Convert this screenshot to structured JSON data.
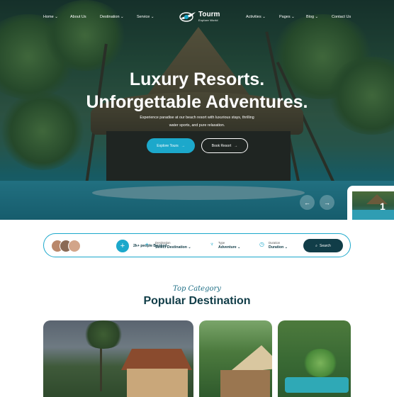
{
  "nav": {
    "items": [
      {
        "label": "Home",
        "dropdown": true
      },
      {
        "label": "About Us",
        "dropdown": false
      },
      {
        "label": "Destination",
        "dropdown": true
      },
      {
        "label": "Service",
        "dropdown": true
      },
      {
        "label": "Activities",
        "dropdown": true
      },
      {
        "label": "Pages",
        "dropdown": true
      },
      {
        "label": "Blog",
        "dropdown": true
      },
      {
        "label": "Contact Us",
        "dropdown": false
      }
    ],
    "logo": {
      "name": "Tourm",
      "tagline": "Explore World"
    }
  },
  "hero": {
    "title_line1": "Luxury Resorts.",
    "title_line2": "Unforgettable Adventures.",
    "subtitle_line1": "Experience paradise at our beach resort with luxurious stays, thrilling",
    "subtitle_line2": "water sports, and pure relaxation.",
    "explore_label": "Explore Tours",
    "book_label": "Book Resort",
    "slide_number": "1"
  },
  "search": {
    "booked_text": "2k+ people Booked",
    "destination": {
      "label": "Destination",
      "value": "Select Destination"
    },
    "type": {
      "label": "Type",
      "value": "Adventure"
    },
    "duration": {
      "label": "Duration",
      "value": "Duration"
    },
    "button_label": "Search"
  },
  "section": {
    "kicker": "Top Category",
    "title": "Popular Destination"
  },
  "colors": {
    "accent": "#1ca8cb",
    "dark": "#113d48"
  },
  "icons": [
    "chevron-down-icon",
    "arrow-right-icon",
    "arrow-left-icon",
    "plus-icon",
    "map-pin-icon",
    "palm-icon",
    "clock-icon",
    "search-icon"
  ]
}
